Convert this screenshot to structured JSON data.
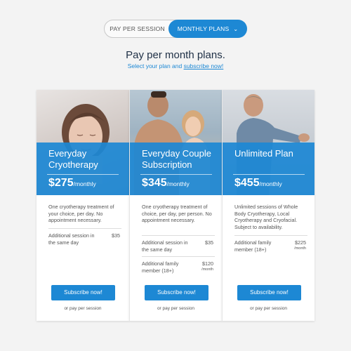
{
  "toggle": {
    "option_a": "PAY PER SESSION",
    "option_b": "MONTHLY PLANS",
    "option_b_icon": "chevron-down-icon"
  },
  "heading": "Pay per month plans.",
  "subheading": {
    "prefix": "Select your plan and ",
    "link": "subscribe now!"
  },
  "colors": {
    "accent": "#1d88d4",
    "heading": "#1e2f45",
    "background": "#f3f3f3"
  },
  "plans": [
    {
      "title": "Everyday Cryotherapy",
      "price": "$275",
      "period": "/monthly",
      "description": "One cryotherapy treatment of your choice, per day. No appointment necessary.",
      "extras": [
        {
          "label": "Additional session in the same day",
          "value": "$35",
          "unit": ""
        }
      ],
      "button": "Subscribe now!",
      "alt_link": "or pay per session"
    },
    {
      "title": "Everyday Couple Subscription",
      "price": "$345",
      "period": "/monthly",
      "description": "One cryotherapy treatment of choice, per day, per person. No appointment necessary.",
      "extras": [
        {
          "label": "Additional session in the same day",
          "value": "$35",
          "unit": ""
        },
        {
          "label": "Additional family member (18+)",
          "value": "$120",
          "unit": "/month"
        }
      ],
      "button": "Subscribe now!",
      "alt_link": "or pay per session"
    },
    {
      "title": "Unlimited Plan",
      "price": "$455",
      "period": "/monthly",
      "description": "Unlimited sessions of Whole Body Cryotherapy, Local Cryotherapy and Cryofacial. Subject to availability.",
      "extras": [
        {
          "label": "Additional family member (18+)",
          "value": "$225",
          "unit": "/month"
        }
      ],
      "button": "Subscribe now!",
      "alt_link": "or pay per session"
    }
  ]
}
